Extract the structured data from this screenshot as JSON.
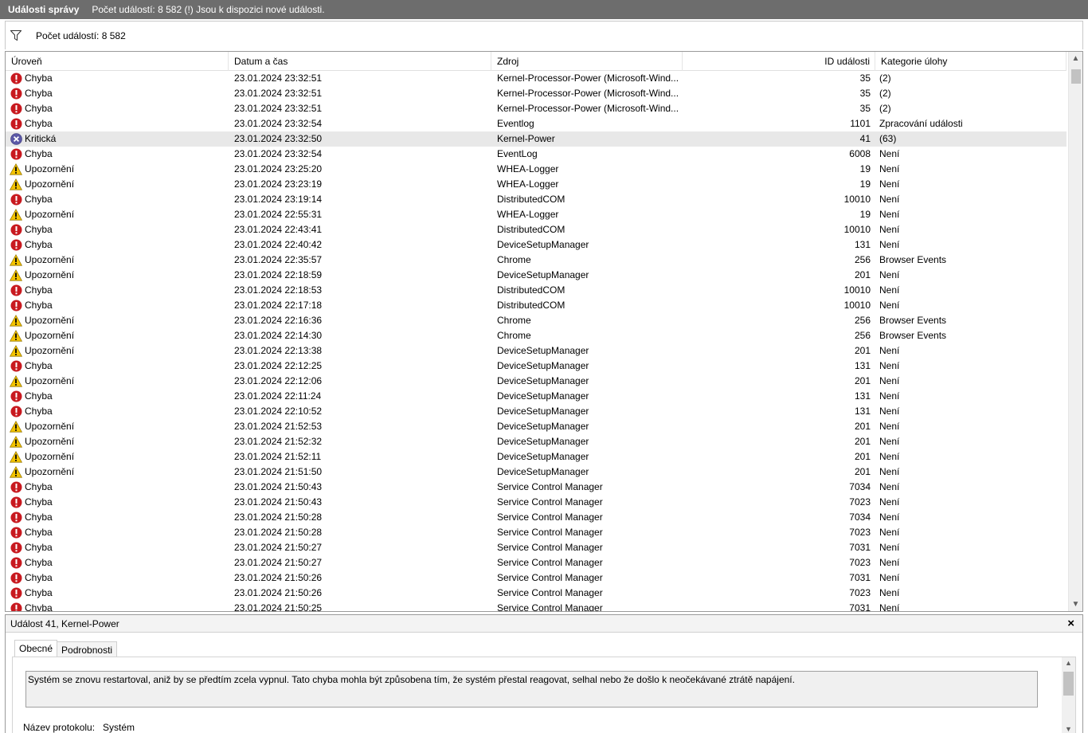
{
  "window": {
    "title": "Události správy",
    "message": "Počet událostí: 8 582 (!) Jsou k dispozici nové události."
  },
  "filter": {
    "label": "Počet událostí: 8 582",
    "icon": "filter-icon"
  },
  "columns": {
    "level": "Úroveň",
    "date": "Datum a čas",
    "source": "Zdroj",
    "id": "ID události",
    "category": "Kategorie úlohy"
  },
  "icons": {
    "error": "error-icon",
    "warning": "warning-icon",
    "critical": "critical-icon"
  },
  "colors": {
    "error": "#c8191f",
    "warning": "#f4c400",
    "critical": "#5b58a6",
    "selected_row": "#e8e8e8"
  },
  "events": [
    {
      "type": "error",
      "level": "Chyba",
      "date": "23.01.2024 23:32:51",
      "source": "Kernel-Processor-Power (Microsoft-Wind...",
      "id": "35",
      "category": "(2)"
    },
    {
      "type": "error",
      "level": "Chyba",
      "date": "23.01.2024 23:32:51",
      "source": "Kernel-Processor-Power (Microsoft-Wind...",
      "id": "35",
      "category": "(2)"
    },
    {
      "type": "error",
      "level": "Chyba",
      "date": "23.01.2024 23:32:51",
      "source": "Kernel-Processor-Power (Microsoft-Wind...",
      "id": "35",
      "category": "(2)"
    },
    {
      "type": "error",
      "level": "Chyba",
      "date": "23.01.2024 23:32:54",
      "source": "Eventlog",
      "id": "1101",
      "category": "Zpracování události"
    },
    {
      "type": "critical",
      "level": "Kritická",
      "date": "23.01.2024 23:32:50",
      "source": "Kernel-Power",
      "id": "41",
      "category": "(63)",
      "selected": true
    },
    {
      "type": "error",
      "level": "Chyba",
      "date": "23.01.2024 23:32:54",
      "source": "EventLog",
      "id": "6008",
      "category": "Není"
    },
    {
      "type": "warning",
      "level": "Upozornění",
      "date": "23.01.2024 23:25:20",
      "source": "WHEA-Logger",
      "id": "19",
      "category": "Není"
    },
    {
      "type": "warning",
      "level": "Upozornění",
      "date": "23.01.2024 23:23:19",
      "source": "WHEA-Logger",
      "id": "19",
      "category": "Není"
    },
    {
      "type": "error",
      "level": "Chyba",
      "date": "23.01.2024 23:19:14",
      "source": "DistributedCOM",
      "id": "10010",
      "category": "Není"
    },
    {
      "type": "warning",
      "level": "Upozornění",
      "date": "23.01.2024 22:55:31",
      "source": "WHEA-Logger",
      "id": "19",
      "category": "Není"
    },
    {
      "type": "error",
      "level": "Chyba",
      "date": "23.01.2024 22:43:41",
      "source": "DistributedCOM",
      "id": "10010",
      "category": "Není"
    },
    {
      "type": "error",
      "level": "Chyba",
      "date": "23.01.2024 22:40:42",
      "source": "DeviceSetupManager",
      "id": "131",
      "category": "Není"
    },
    {
      "type": "warning",
      "level": "Upozornění",
      "date": "23.01.2024 22:35:57",
      "source": "Chrome",
      "id": "256",
      "category": "Browser Events"
    },
    {
      "type": "warning",
      "level": "Upozornění",
      "date": "23.01.2024 22:18:59",
      "source": "DeviceSetupManager",
      "id": "201",
      "category": "Není"
    },
    {
      "type": "error",
      "level": "Chyba",
      "date": "23.01.2024 22:18:53",
      "source": "DistributedCOM",
      "id": "10010",
      "category": "Není"
    },
    {
      "type": "error",
      "level": "Chyba",
      "date": "23.01.2024 22:17:18",
      "source": "DistributedCOM",
      "id": "10010",
      "category": "Není"
    },
    {
      "type": "warning",
      "level": "Upozornění",
      "date": "23.01.2024 22:16:36",
      "source": "Chrome",
      "id": "256",
      "category": "Browser Events"
    },
    {
      "type": "warning",
      "level": "Upozornění",
      "date": "23.01.2024 22:14:30",
      "source": "Chrome",
      "id": "256",
      "category": "Browser Events"
    },
    {
      "type": "warning",
      "level": "Upozornění",
      "date": "23.01.2024 22:13:38",
      "source": "DeviceSetupManager",
      "id": "201",
      "category": "Není"
    },
    {
      "type": "error",
      "level": "Chyba",
      "date": "23.01.2024 22:12:25",
      "source": "DeviceSetupManager",
      "id": "131",
      "category": "Není"
    },
    {
      "type": "warning",
      "level": "Upozornění",
      "date": "23.01.2024 22:12:06",
      "source": "DeviceSetupManager",
      "id": "201",
      "category": "Není"
    },
    {
      "type": "error",
      "level": "Chyba",
      "date": "23.01.2024 22:11:24",
      "source": "DeviceSetupManager",
      "id": "131",
      "category": "Není"
    },
    {
      "type": "error",
      "level": "Chyba",
      "date": "23.01.2024 22:10:52",
      "source": "DeviceSetupManager",
      "id": "131",
      "category": "Není"
    },
    {
      "type": "warning",
      "level": "Upozornění",
      "date": "23.01.2024 21:52:53",
      "source": "DeviceSetupManager",
      "id": "201",
      "category": "Není"
    },
    {
      "type": "warning",
      "level": "Upozornění",
      "date": "23.01.2024 21:52:32",
      "source": "DeviceSetupManager",
      "id": "201",
      "category": "Není"
    },
    {
      "type": "warning",
      "level": "Upozornění",
      "date": "23.01.2024 21:52:11",
      "source": "DeviceSetupManager",
      "id": "201",
      "category": "Není"
    },
    {
      "type": "warning",
      "level": "Upozornění",
      "date": "23.01.2024 21:51:50",
      "source": "DeviceSetupManager",
      "id": "201",
      "category": "Není"
    },
    {
      "type": "error",
      "level": "Chyba",
      "date": "23.01.2024 21:50:43",
      "source": "Service Control Manager",
      "id": "7034",
      "category": "Není"
    },
    {
      "type": "error",
      "level": "Chyba",
      "date": "23.01.2024 21:50:43",
      "source": "Service Control Manager",
      "id": "7023",
      "category": "Není"
    },
    {
      "type": "error",
      "level": "Chyba",
      "date": "23.01.2024 21:50:28",
      "source": "Service Control Manager",
      "id": "7034",
      "category": "Není"
    },
    {
      "type": "error",
      "level": "Chyba",
      "date": "23.01.2024 21:50:28",
      "source": "Service Control Manager",
      "id": "7023",
      "category": "Není"
    },
    {
      "type": "error",
      "level": "Chyba",
      "date": "23.01.2024 21:50:27",
      "source": "Service Control Manager",
      "id": "7031",
      "category": "Není"
    },
    {
      "type": "error",
      "level": "Chyba",
      "date": "23.01.2024 21:50:27",
      "source": "Service Control Manager",
      "id": "7023",
      "category": "Není"
    },
    {
      "type": "error",
      "level": "Chyba",
      "date": "23.01.2024 21:50:26",
      "source": "Service Control Manager",
      "id": "7031",
      "category": "Není"
    },
    {
      "type": "error",
      "level": "Chyba",
      "date": "23.01.2024 21:50:26",
      "source": "Service Control Manager",
      "id": "7023",
      "category": "Není"
    },
    {
      "type": "error",
      "level": "Chyba",
      "date": "23.01.2024 21:50:25",
      "source": "Service Control Manager",
      "id": "7031",
      "category": "Není"
    }
  ],
  "detail": {
    "title": "Událost 41, Kernel-Power",
    "close": "×",
    "tabs": [
      "Obecné",
      "Podrobnosti"
    ],
    "active_tab": "Obecné",
    "description": "Systém se znovu restartoval, aniž by se předtím zcela vypnul. Tato chyba mohla být způsobena tím, že systém přestal reagovat, selhal nebo že došlo k neočekávané ztrátě napájení.",
    "protocol_label": "Název protokolu:",
    "protocol_value": "Systém"
  }
}
